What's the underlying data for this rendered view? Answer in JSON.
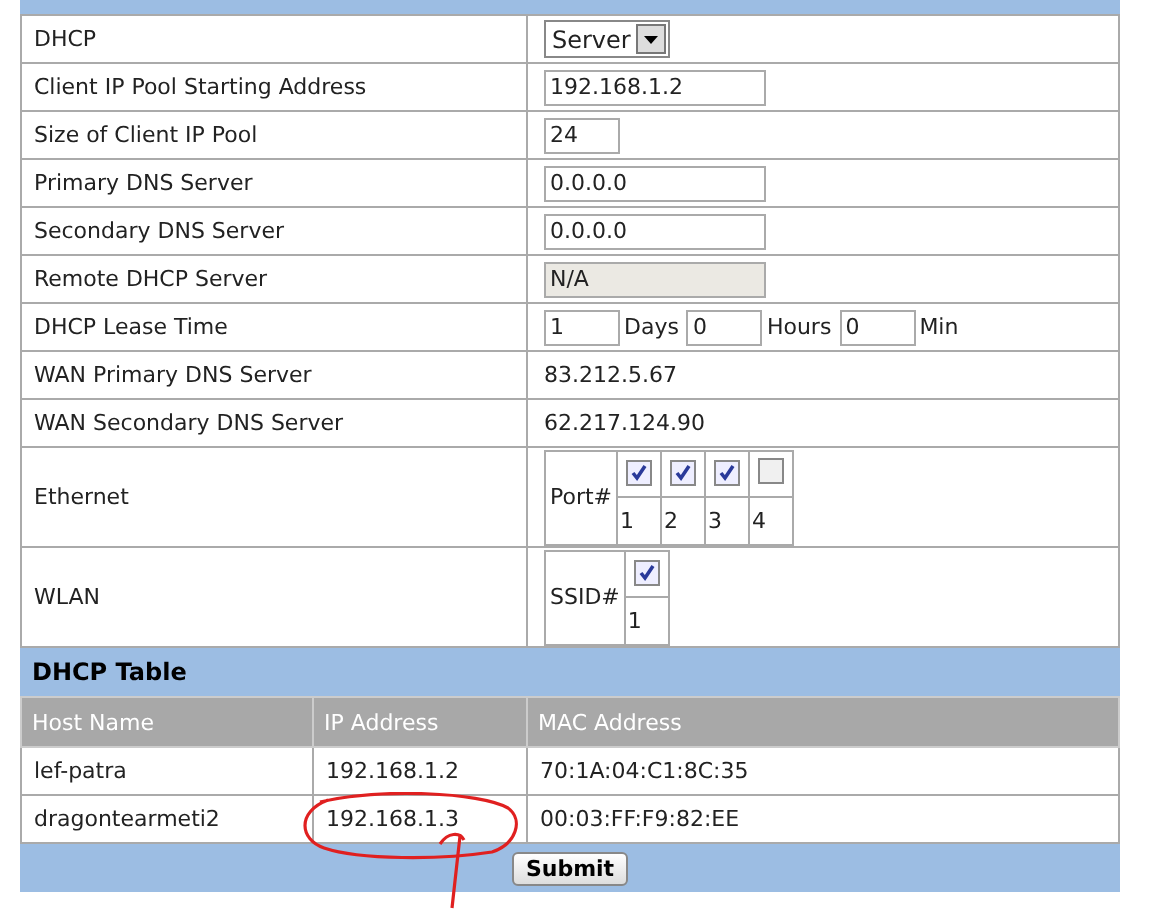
{
  "settings": [
    {
      "kind": "select",
      "label": "DHCP",
      "value": "Server"
    },
    {
      "kind": "input",
      "label": "Client IP Pool Starting Address",
      "value": "192.168.1.2"
    },
    {
      "kind": "short_input",
      "label": "Size of Client IP Pool",
      "value": "24"
    },
    {
      "kind": "input",
      "label": "Primary DNS Server",
      "value": "0.0.0.0"
    },
    {
      "kind": "input",
      "label": "Secondary DNS Server",
      "value": "0.0.0.0"
    },
    {
      "kind": "input",
      "label": "Remote DHCP Server",
      "value": "N/A",
      "disabled": true
    },
    {
      "kind": "lease",
      "label": "DHCP Lease Time",
      "parts": [
        {
          "value": "1",
          "unit": "Days"
        },
        {
          "value": "0",
          "unit": "Hours"
        },
        {
          "value": "0",
          "unit": "Min"
        }
      ]
    },
    {
      "kind": "text",
      "label": "WAN Primary DNS Server",
      "value": "83.212.5.67"
    },
    {
      "kind": "text",
      "label": "WAN Secondary DNS Server",
      "value": "62.217.124.90"
    },
    {
      "kind": "ports",
      "label": "Ethernet",
      "heading": "Port#",
      "ports": [
        {
          "number": "1",
          "checked": true
        },
        {
          "number": "2",
          "checked": true
        },
        {
          "number": "3",
          "checked": true
        },
        {
          "number": "4",
          "checked": false
        }
      ]
    },
    {
      "kind": "ports",
      "label": "WLAN",
      "heading": "SSID#",
      "ports": [
        {
          "number": "1",
          "checked": true
        }
      ]
    }
  ],
  "dhcp_table": {
    "title": "DHCP Table",
    "columns": [
      "Host Name",
      "IP Address",
      "MAC Address"
    ],
    "rows": [
      [
        "lef-patra",
        "192.168.1.2",
        "70:1A:04:C1:8C:35"
      ],
      [
        "dragontearmeti2",
        "192.168.1.3",
        "00:03:FF:F9:82:EE"
      ]
    ]
  },
  "submit": "Submit"
}
